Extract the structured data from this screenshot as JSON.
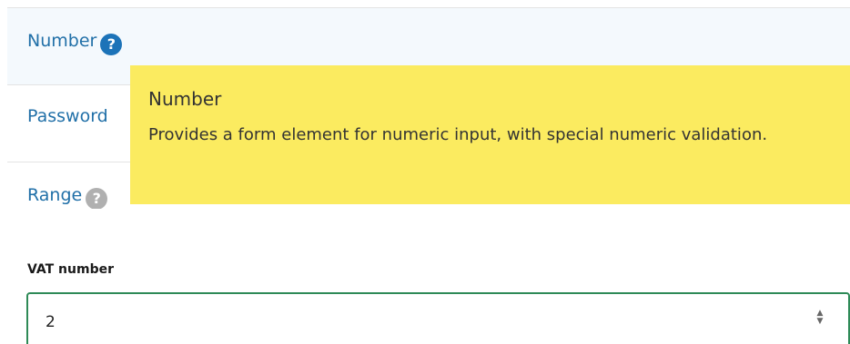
{
  "input_types": {
    "items": [
      {
        "label": "Number"
      },
      {
        "label": "Password"
      },
      {
        "label": "Range"
      }
    ],
    "help_glyph": "?"
  },
  "tooltip": {
    "title": "Number",
    "body": "Provides a form element for numeric input, with special numeric validation."
  },
  "form": {
    "vat_label": "VAT number",
    "vat_value": "2",
    "spinner_up": "▲",
    "spinner_down": "▼"
  },
  "colors": {
    "link": "#2170a8",
    "help_active": "#1c73b8",
    "help_inactive": "#b0b0b0",
    "tooltip_bg": "#fbeb60",
    "input_border": "#2e8a57"
  },
  "icons": {
    "help": "question-circle-icon",
    "spinner": "number-spinner-icon"
  }
}
